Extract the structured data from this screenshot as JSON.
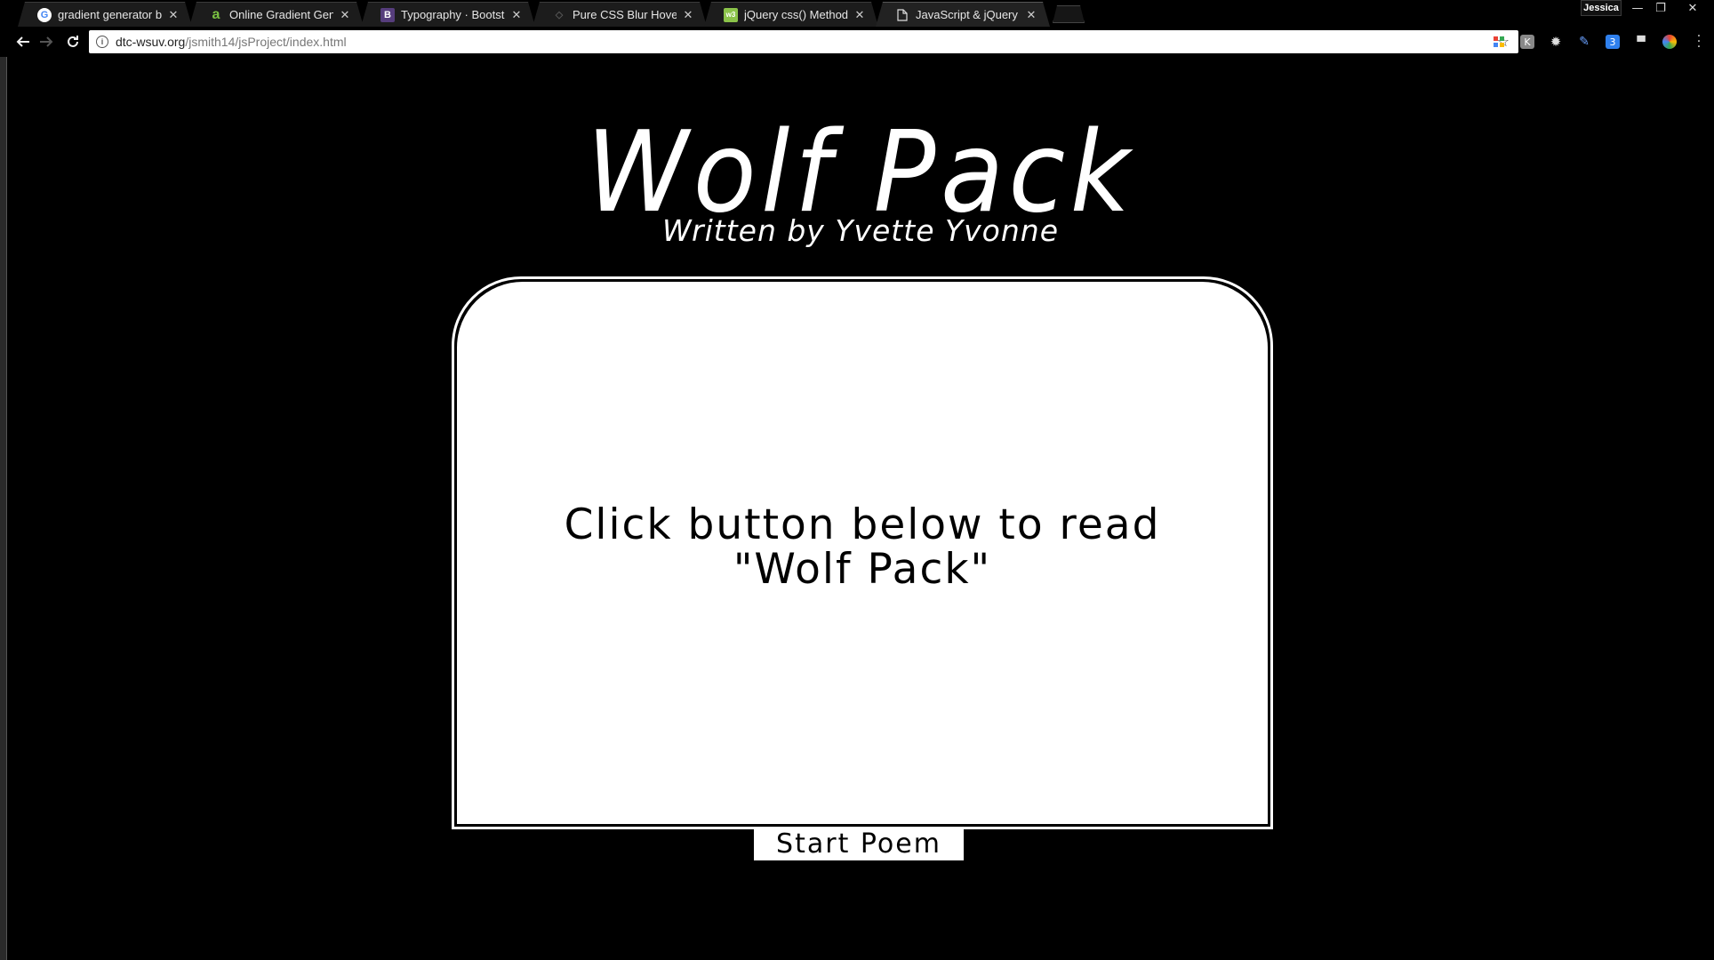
{
  "browser": {
    "tabs": [
      {
        "title": "gradient generator back",
        "favicon": "google-icon",
        "favicon_glyph": "G",
        "favicon_color": "#4285f4",
        "active": false
      },
      {
        "title": "Online Gradient Generat",
        "favicon": "a-icon",
        "favicon_glyph": "a",
        "favicon_color": "#7ac142",
        "active": false
      },
      {
        "title": "Typography · Bootstrap",
        "favicon": "bootstrap-icon",
        "favicon_glyph": "B",
        "favicon_color": "#563d7c",
        "active": false
      },
      {
        "title": "Pure CSS Blur Hover Effe",
        "favicon": "codepen-icon",
        "favicon_glyph": "",
        "favicon_color": "#222222",
        "active": false
      },
      {
        "title": "jQuery css() Method",
        "favicon": "w3schools-icon",
        "favicon_glyph": "w3",
        "favicon_color": "#8bc34a",
        "active": false
      },
      {
        "title": "JavaScript & jQuery | Inte",
        "favicon": "page-icon",
        "favicon_glyph": "",
        "favicon_color": "#ffffff",
        "active": true
      }
    ],
    "profile_name": "Jessica",
    "url_host": "dtc-wsuv.org",
    "url_path": "/jsmith14/jsProject/index.html"
  },
  "page": {
    "title": "Wolf Pack",
    "subtitle": "Written by Yvette Yvonne",
    "poem_prompt_line1": "Click button below to read",
    "poem_prompt_line2": "\"Wolf Pack\"",
    "start_button": "Start Poem"
  },
  "colors": {
    "background": "#000000",
    "card": "#ffffff",
    "text_light": "#ffffff",
    "text_dark": "#000000"
  }
}
